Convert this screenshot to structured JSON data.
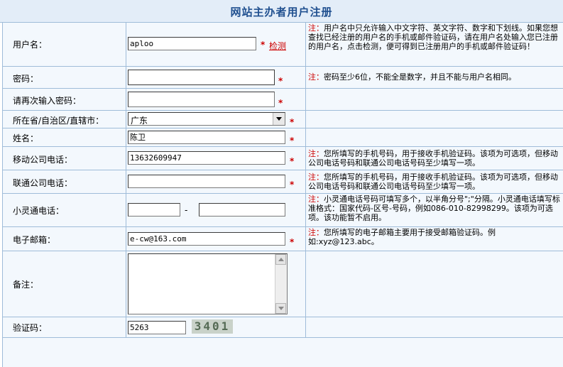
{
  "page_title": "网站主办者用户注册",
  "note_prefix": "注：",
  "required_mark": "*",
  "fields": {
    "username": {
      "label": "用户名：",
      "value": "aploo",
      "check_link": "检测",
      "note": "用户名中只允许输入中文字符、英文字符、数字和下划线。如果您想查找已经注册的用户名的手机或邮件验证码，请在用户名处输入您已注册的用户名，点击检测，便可得到已注册用户的手机或邮件验证码！"
    },
    "password": {
      "label": "密码：",
      "value": "",
      "note": "密码至少6位，不能全是数字，并且不能与用户名相同。"
    },
    "password_confirm": {
      "label": "请再次输入密码：",
      "value": ""
    },
    "province": {
      "label": "所在省/自治区/直辖市：",
      "selected": "广东"
    },
    "name": {
      "label": "姓名：",
      "value": "陈卫"
    },
    "mobile": {
      "label": "移动公司电话：",
      "value": "13632609947",
      "note": "您所填写的手机号码，用于接收手机验证码。该项为可选项，但移动公司电话号码和联通公司电话号码至少填写一项。"
    },
    "unicom": {
      "label": "联通公司电话：",
      "value": "",
      "note": "您所填写的手机号码，用于接收手机验证码。该项为可选项，但移动公司电话号码和联通公司电话号码至少填写一项。"
    },
    "phs": {
      "label": "小灵通电话：",
      "area_code": "",
      "number": "",
      "separator": "-",
      "note": "小灵通电话号码可填写多个，以半角分号\";\"分隔。小灵通电话填写标准格式：国家代码-区号-号码，例如086-010-82998299。该项为可选项。该功能暂不启用。"
    },
    "email": {
      "label": "电子邮箱：",
      "value": "e-cw@163.com",
      "note": "您所填写的电子邮箱主要用于接受邮箱验证码。例如:xyz@123.abc。"
    },
    "remarks": {
      "label": "备注：",
      "value": ""
    },
    "captcha": {
      "label": "验证码：",
      "value": "5263",
      "image_text": "3401"
    }
  }
}
